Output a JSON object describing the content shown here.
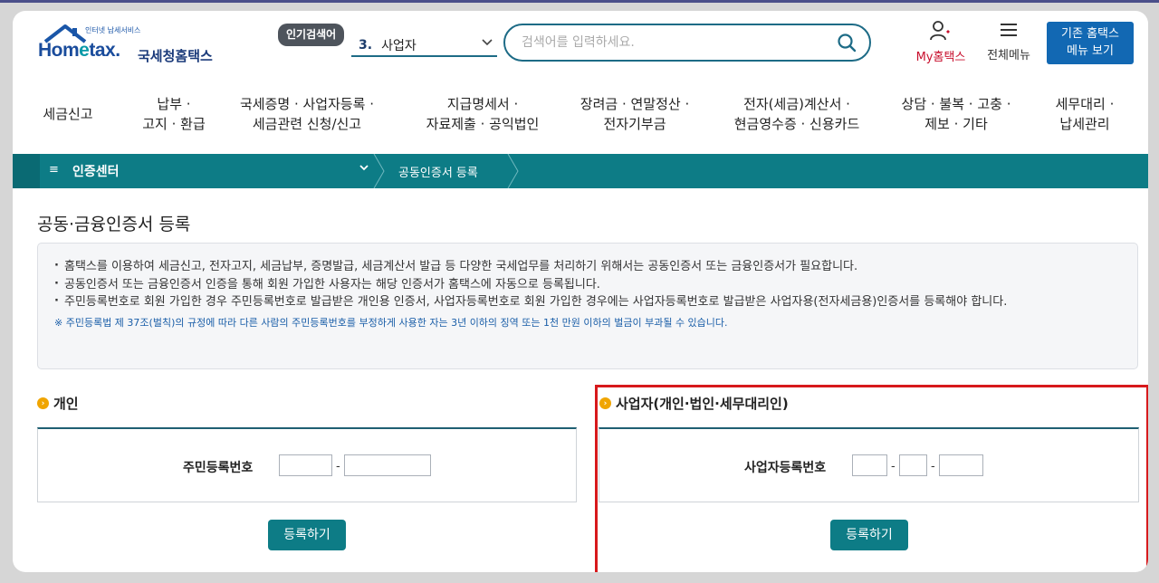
{
  "header": {
    "logo_sub": "인터넷 납세서비스",
    "logo_home": "Hom",
    "logo_e": "e",
    "logo_tax": "tax.",
    "logo_nts": "국세청홈택스",
    "popular_badge": "인기검색어",
    "popular_rank": "3.",
    "popular_term": "사업자",
    "search_placeholder": "검색어를 입력하세요.",
    "mytax_label": "My홈택스",
    "allmenu_label": "전체메뉴",
    "oldtax_line1": "기존 홈택스",
    "oldtax_line2": "메뉴 보기"
  },
  "nav": [
    {
      "line1": "세금신고",
      "line2": ""
    },
    {
      "line1": "납부 ·",
      "line2": "고지 · 환급"
    },
    {
      "line1": "국세증명 · 사업자등록 ·",
      "line2": "세금관련 신청/신고"
    },
    {
      "line1": "지급명세서 ·",
      "line2": "자료제출 · 공익법인"
    },
    {
      "line1": "장려금 · 연말정산 ·",
      "line2": "전자기부금"
    },
    {
      "line1": "전자(세금)계산서 ·",
      "line2": "현금영수증 · 신용카드"
    },
    {
      "line1": "상담 · 불복 · 고충 ·",
      "line2": "제보 · 기타"
    },
    {
      "line1": "세무대리 ·",
      "line2": "납세관리"
    }
  ],
  "breadcrumb": {
    "menu_icon": "≡",
    "section": "인증센터",
    "current": "공동인증서 등록"
  },
  "page": {
    "title": "공동·금융인증서 등록",
    "info": [
      "홈택스를 이용하여 세금신고, 전자고지, 세금납부, 증명발급, 세금계산서 발급 등 다양한 국세업무를 처리하기 위해서는 공동인증서 또는 금융인증서가 필요합니다.",
      "공동인증서 또는 금융인증서 인증을 통해 회원 가입한 사용자는 해당 인증서가 홈택스에 자동으로 등록됩니다.",
      "주민등록번호로 회원 가입한 경우 주민등록번호로 발급받은 개인용 인증서, 사업자등록번호로 회원 가입한 경우에는 사업자등록번호로 발급받은 사업자용(전자세금용)인증서를 등록해야 합니다."
    ],
    "note": "※ 주민등록법 제 37조(벌칙)의 규정에 따라 다른 사람의 주민등록번호를 부정하게 사용한 자는 3년 이하의 징역 또는 1천 만원 이하의 벌금이 부과될 수 있습니다."
  },
  "personal": {
    "title": "개인",
    "field_label": "주민등록번호",
    "dash": "-",
    "part1": "",
    "part2": "",
    "register_button": "등록하기"
  },
  "business": {
    "title": "사업자(개인·법인·세무대리인)",
    "field_label": "사업자등록번호",
    "dash": "-",
    "part1": "",
    "part2": "",
    "part3": "",
    "register_button": "등록하기"
  },
  "colors": {
    "teal": "#0d7c86",
    "brand_blue": "#1268b3",
    "highlight_red": "#d7191c",
    "bullet_orange": "#f0a500"
  }
}
